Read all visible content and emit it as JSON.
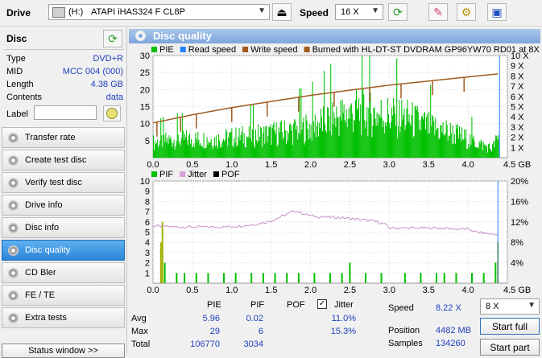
{
  "toolbar": {
    "drive_label": "Drive",
    "drive_letter": "(H:)",
    "drive_name": "ATAPI iHAS324   F CL8P",
    "speed_label": "Speed",
    "speed_value": "16 X"
  },
  "disc": {
    "header": "Disc",
    "rows": [
      {
        "key": "Type",
        "value": "DVD+R"
      },
      {
        "key": "MID",
        "value": "MCC 004 (000)"
      },
      {
        "key": "Length",
        "value": "4.38 GB"
      },
      {
        "key": "Contents",
        "value": "data"
      }
    ],
    "label_key": "Label",
    "label_value": ""
  },
  "nav": [
    {
      "label": "Transfer rate",
      "active": false
    },
    {
      "label": "Create test disc",
      "active": false
    },
    {
      "label": "Verify test disc",
      "active": false
    },
    {
      "label": "Drive info",
      "active": false
    },
    {
      "label": "Disc info",
      "active": false
    },
    {
      "label": "Disc quality",
      "active": true
    },
    {
      "label": "CD Bler",
      "active": false
    },
    {
      "label": "FE / TE",
      "active": false
    },
    {
      "label": "Extra tests",
      "active": false
    }
  ],
  "status_window": "Status window >>",
  "panel_title": "Disc quality",
  "chart_data": [
    {
      "type": "bar",
      "legend": [
        {
          "name": "PIE",
          "color": "#00c000"
        },
        {
          "name": "Read speed",
          "color": "#2080ff"
        },
        {
          "name": "Write speed",
          "color": "#a05a20"
        },
        {
          "name": "Burned with HL-DT-ST DVDRAM GP96YW70 RD01 at 8X",
          "color": "#a05a20"
        }
      ],
      "x_ticks": [
        "0.0",
        "0.5",
        "1.0",
        "1.5",
        "2.0",
        "2.5",
        "3.0",
        "3.5",
        "4.0",
        "4.5 GB"
      ],
      "y_left_ticks": [
        "5",
        "10",
        "15",
        "20",
        "25",
        "30"
      ],
      "y_right_ticks": [
        "1 X",
        "2 X",
        "3 X",
        "4 X",
        "5 X",
        "6 X",
        "7 X",
        "8 X",
        "9 X",
        "10 X"
      ],
      "xlim": [
        0,
        4.5
      ],
      "ylim_left": [
        0,
        30
      ],
      "ylim_right": [
        0,
        10
      ],
      "pie_profile": [
        [
          0.0,
          5
        ],
        [
          0.3,
          6
        ],
        [
          0.8,
          6
        ],
        [
          1.2,
          7
        ],
        [
          1.6,
          8
        ],
        [
          2.0,
          10
        ],
        [
          2.3,
          13
        ],
        [
          2.6,
          15
        ],
        [
          2.9,
          14
        ],
        [
          3.2,
          13
        ],
        [
          3.5,
          10
        ],
        [
          3.8,
          8
        ],
        [
          4.1,
          5
        ],
        [
          4.3,
          3
        ],
        [
          4.4,
          7
        ]
      ],
      "read_speed_x": 4.4,
      "read_speed": [
        [
          0.0,
          3.4
        ],
        [
          0.5,
          4.2
        ],
        [
          1.0,
          4.9
        ],
        [
          1.5,
          5.5
        ],
        [
          2.0,
          6.1
        ],
        [
          2.5,
          6.6
        ],
        [
          3.0,
          7.1
        ],
        [
          3.5,
          7.5
        ],
        [
          4.0,
          7.9
        ],
        [
          4.38,
          8.2
        ]
      ],
      "write_dips": [
        0.05,
        0.35,
        0.55,
        1.0,
        1.45,
        1.85,
        2.3,
        2.75,
        3.15,
        3.55,
        3.95
      ]
    },
    {
      "type": "bar",
      "legend": [
        {
          "name": "PIF",
          "color": "#00c000"
        },
        {
          "name": "Jitter",
          "color": "#d7a0d7"
        },
        {
          "name": "POF",
          "color": "#000000"
        }
      ],
      "x_ticks": [
        "0.0",
        "0.5",
        "1.0",
        "1.5",
        "2.0",
        "2.5",
        "3.0",
        "3.5",
        "4.0",
        "4.5 GB"
      ],
      "y_left_ticks": [
        "1",
        "2",
        "3",
        "4",
        "5",
        "6",
        "7",
        "8",
        "9",
        "10"
      ],
      "y_right_ticks": [
        "4%",
        "8%",
        "12%",
        "16%",
        "20%"
      ],
      "xlim": [
        0,
        4.5
      ],
      "ylim_left": [
        0,
        10
      ],
      "ylim_right": [
        0,
        20
      ],
      "pif_spikes": [
        [
          0.1,
          4
        ],
        [
          0.12,
          6
        ],
        [
          0.15,
          2
        ],
        [
          0.3,
          1
        ],
        [
          0.4,
          1
        ],
        [
          0.55,
          1
        ],
        [
          0.7,
          1
        ],
        [
          0.9,
          1
        ],
        [
          1.05,
          1
        ],
        [
          1.25,
          1
        ],
        [
          1.4,
          1
        ],
        [
          1.55,
          1
        ],
        [
          1.7,
          1
        ],
        [
          1.85,
          1
        ],
        [
          2.05,
          1
        ],
        [
          2.25,
          1
        ],
        [
          2.4,
          1
        ],
        [
          2.5,
          2
        ],
        [
          2.7,
          1
        ],
        [
          2.9,
          1
        ],
        [
          3.2,
          1
        ],
        [
          3.4,
          1
        ],
        [
          3.6,
          1
        ],
        [
          3.7,
          1
        ],
        [
          3.85,
          1
        ],
        [
          4.05,
          1
        ],
        [
          4.2,
          1
        ],
        [
          4.35,
          2
        ],
        [
          4.38,
          4
        ]
      ],
      "jitter": [
        [
          0.0,
          11.2
        ],
        [
          0.3,
          11.0
        ],
        [
          0.6,
          11.0
        ],
        [
          0.9,
          11.0
        ],
        [
          1.1,
          11.2
        ],
        [
          1.3,
          11.5
        ],
        [
          1.5,
          12.2
        ],
        [
          1.7,
          13.5
        ],
        [
          1.8,
          14.2
        ],
        [
          1.95,
          13.4
        ],
        [
          2.1,
          13.0
        ],
        [
          2.4,
          12.8
        ],
        [
          2.6,
          12.5
        ],
        [
          2.8,
          12.2
        ],
        [
          2.95,
          11.5
        ],
        [
          3.0,
          10.8
        ],
        [
          3.3,
          10.8
        ],
        [
          3.6,
          10.8
        ],
        [
          3.85,
          10.6
        ],
        [
          4.0,
          10.6
        ],
        [
          4.1,
          10.0
        ],
        [
          4.3,
          9.6
        ],
        [
          4.38,
          9.6
        ]
      ]
    }
  ],
  "stats": {
    "col_pie": "PIE",
    "col_pif": "PIF",
    "col_pof": "POF",
    "col_jitter": "Jitter",
    "jitter_checked": true,
    "rows": [
      {
        "label": "Avg",
        "pie": "5.96",
        "pif": "0.02",
        "jitter": "11.0%"
      },
      {
        "label": "Max",
        "pie": "29",
        "pif": "6",
        "jitter": "15.3%"
      },
      {
        "label": "Total",
        "pie": "106770",
        "pif": "3034",
        "jitter": ""
      }
    ],
    "speed_label": "Speed",
    "speed_value": "8.22 X",
    "position_label": "Position",
    "position_value": "4482 MB",
    "samples_label": "Samples",
    "samples_value": "134260",
    "speed_select": "8 X",
    "start_full": "Start full",
    "start_part": "Start part"
  }
}
